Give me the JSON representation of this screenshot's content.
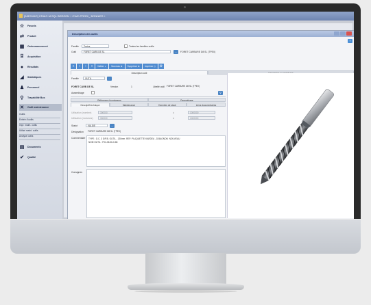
{
  "app": {
    "title": "[A3E01MO] CRAIG M.SQL BERGEN + C\\A3\\ PROD\\_ BONNIES +",
    "accent": "#4f8bd0"
  },
  "sidebar": {
    "items": [
      {
        "label": "Favoris",
        "icon": "star-icon",
        "glyph": "☆"
      },
      {
        "label": "Produit",
        "icon": "arrows-icon",
        "glyph": "⇄"
      },
      {
        "label": "Ordonnancement",
        "icon": "calendar-icon",
        "glyph": "▦"
      },
      {
        "label": "Acquisition",
        "icon": "tray-icon",
        "glyph": "⍗"
      },
      {
        "label": "Résultats",
        "icon": "bullet-icon",
        "glyph": "●"
      },
      {
        "label": "Statistiques",
        "icon": "chart-icon",
        "glyph": "◢"
      },
      {
        "label": "Personnel",
        "icon": "person-icon",
        "glyph": "♟"
      },
      {
        "label": "Traçabilité Bus",
        "icon": "magnifier-icon",
        "glyph": "⚲"
      },
      {
        "label": "Outil maintenance",
        "icon": "tools-icon",
        "glyph": "✕"
      },
      {
        "label": "Documents",
        "icon": "document-icon",
        "glyph": "▤"
      },
      {
        "label": "Qualité",
        "icon": "check-circle-icon",
        "glyph": "✔"
      }
    ],
    "subitems": [
      "Outils",
      "Entrée d'outils",
      "Impr. maint. outils",
      "Utilisé maint. outils",
      "Analyse outils"
    ]
  },
  "window": {
    "title": "Description des outils",
    "famille_label": "Famille",
    "famille_value": "Toutes",
    "famille_checkbox_label": "Toutes les familles outils",
    "outil_label": "Outil",
    "outil_value": "FORET CARB DE SL",
    "outil_desc": "FORET CARBURE D8 SL (TPEX)"
  },
  "toolbar": {
    "nav": [
      "«",
      "‹",
      "›",
      "»"
    ],
    "buttons": [
      "Valider ✔",
      "Nouveau ✚",
      "Supprimer ✖",
      "Imprimer ⎙"
    ],
    "extra": "⚙"
  },
  "tabs_top": [
    "Description outil",
    "Description ou proteinage"
  ],
  "form": {
    "famille_label": "Famille",
    "famille_value": "OUTIL",
    "code_label": "FORET CARB DE SL",
    "version_label": "Version",
    "version_value": "1",
    "libelle_label": "Libellé outil",
    "libelle_value": "FORET CARBURE D8 SL (TPEX)",
    "assemblage_label": "Assemblage"
  },
  "tabs_mid": [
    "Références fournisseurs",
    "Paramétrage"
  ],
  "tabs_sub": [
    "Descriptif technique",
    "Maintenance",
    "Données de stock",
    "Liens documentaires"
  ],
  "details": {
    "utilisation_label": "Utilisation (nombre)",
    "utilisation_value": "300000",
    "utilisation_max": "1000000",
    "utilisation2_label": "Utilisation (mois/ans)",
    "utilisation2_value": "300000",
    "utilisation2_max": "1000000",
    "statut_label": "Statut",
    "statut_value": "VALIDE",
    "designation_label": "Désignation",
    "designation_value": "FORET CARBURE D8 SL (TPEX)",
    "commentaire_label": "Commentaire",
    "commentaire_value": "TYPE : D.C. 3 D/P.B. OUTIL - 130mm  REF: PLAQUETTE KARDEA - D.BAGNON  NOUVEAU\nNOM OUTIL : F01-06-06-0-66",
    "consignes_label": "Consignes"
  }
}
